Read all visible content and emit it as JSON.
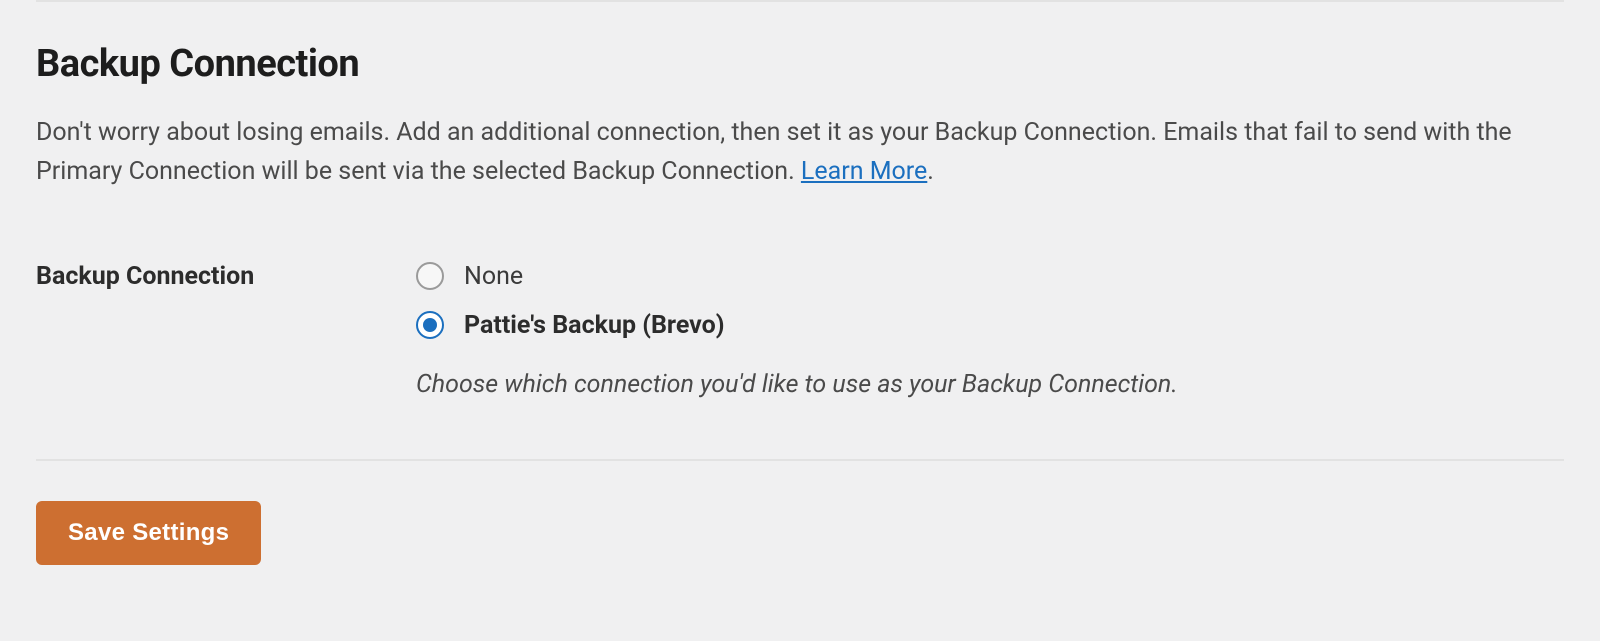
{
  "section": {
    "title": "Backup Connection",
    "description_part1": "Don't worry about losing emails. Add an additional connection, then set it as your Backup Connection. Emails that fail to send with the Primary Connection will be sent via the selected Backup Connection. ",
    "learn_more_text": "Learn More",
    "description_part2": "."
  },
  "form": {
    "label": "Backup Connection",
    "options": [
      {
        "label": "None",
        "selected": false
      },
      {
        "label": "Pattie's Backup (Brevo)",
        "selected": true
      }
    ],
    "help_text": "Choose which connection you'd like to use as your Backup Connection."
  },
  "buttons": {
    "save_label": "Save Settings"
  }
}
